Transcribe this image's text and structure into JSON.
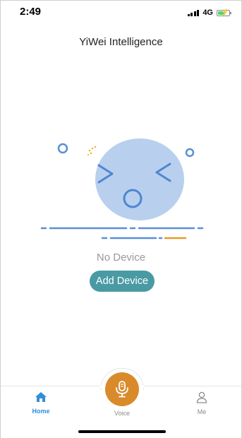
{
  "status_bar": {
    "time": "2:49",
    "network": "4G",
    "signal_bars": 4,
    "battery_level": 0.6,
    "battery_charging": true
  },
  "header": {
    "title": "YiWei Intelligence"
  },
  "main": {
    "illustration_icon": "surprised-face-icon",
    "empty_message": "No Device",
    "add_device_label": "Add Device"
  },
  "tab_bar": {
    "active": "Home",
    "tabs": [
      {
        "label": "Home",
        "icon": "home-icon"
      },
      {
        "label": "Voice",
        "icon": "microphone-icon"
      },
      {
        "label": "Me",
        "icon": "user-icon"
      }
    ]
  },
  "colors": {
    "accent_teal": "#4a9aa3",
    "voice_orange": "#d98a2b",
    "active_tab_blue": "#2f8fd8",
    "illustration_blue": "#b8d0ee",
    "stroke_blue": "#5a8fd6"
  }
}
